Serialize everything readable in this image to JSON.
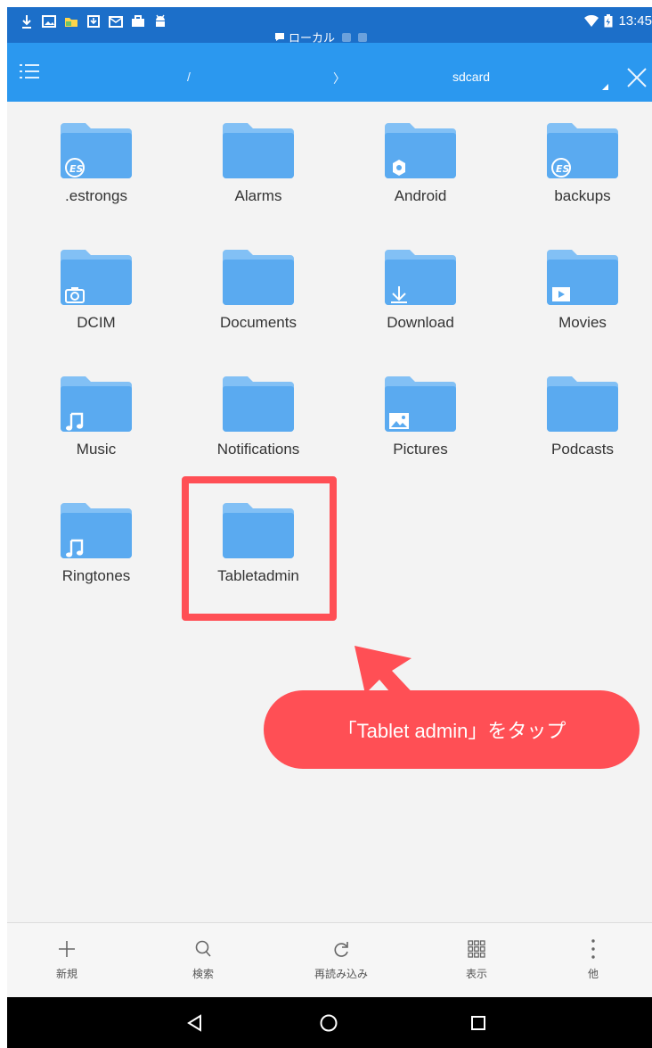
{
  "status_bar": {
    "time": "13:45",
    "notification_icons": [
      "download-icon",
      "image-icon",
      "folder-color-icon",
      "download-box-icon",
      "mail-icon",
      "briefcase-icon",
      "android-icon"
    ],
    "location_label": "ローカル"
  },
  "toolbar": {
    "path_root": "/",
    "path_separator": "〉",
    "path_current": "sdcard"
  },
  "folders": [
    {
      "name": ".estrongs",
      "badge": "es-icon"
    },
    {
      "name": "Alarms",
      "badge": ""
    },
    {
      "name": "Android",
      "badge": "gear-icon"
    },
    {
      "name": "backups",
      "badge": "es-icon"
    },
    {
      "name": "DCIM",
      "badge": "camera-icon"
    },
    {
      "name": "Documents",
      "badge": ""
    },
    {
      "name": "Download",
      "badge": "download-arrow-icon"
    },
    {
      "name": "Movies",
      "badge": "play-icon"
    },
    {
      "name": "Music",
      "badge": "music-note-icon"
    },
    {
      "name": "Notifications",
      "badge": ""
    },
    {
      "name": "Pictures",
      "badge": "picture-icon"
    },
    {
      "name": "Podcasts",
      "badge": ""
    },
    {
      "name": "Ringtones",
      "badge": "music-note-icon"
    },
    {
      "name": "Tabletadmin",
      "badge": ""
    }
  ],
  "callout": {
    "text": "「Tablet admin」をタップ"
  },
  "bottom_bar": {
    "items": [
      {
        "label": "新規",
        "icon": "plus-icon"
      },
      {
        "label": "検索",
        "icon": "search-icon"
      },
      {
        "label": "再読み込み",
        "icon": "refresh-icon"
      },
      {
        "label": "表示",
        "icon": "grid-view-icon"
      },
      {
        "label": "他",
        "icon": "more-vertical-icon"
      }
    ]
  },
  "colors": {
    "status_bar": "#1c6fc9",
    "toolbar": "#2b98ef",
    "folder": "#5aaaf0",
    "folder_tab": "#82c0f5",
    "highlight": "#ff4f55",
    "background": "#f3f3f3"
  }
}
